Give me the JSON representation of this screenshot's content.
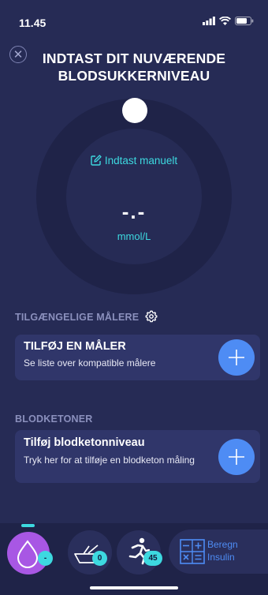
{
  "status_bar": {
    "time": "11.45"
  },
  "header": {
    "title": "INDTAST DIT NUVÆRENDE BLODSUKKERNIVEAU"
  },
  "dial": {
    "manual_entry_label": "Indtast manuelt",
    "reading": "-.-",
    "unit": "mmol/L"
  },
  "meters": {
    "section_label": "TILGÆNGELIGE MÅLERE",
    "card_title": "TILFØJ EN MÅLER",
    "card_subtitle": "Se liste over kompatible målere"
  },
  "ketones": {
    "section_label": "BLODKETONER",
    "card_title": "Tilføj blodketonniveau",
    "card_subtitle": "Tryk her for at tilføje en blodketon måling"
  },
  "tab_bar": {
    "glucose_badge": "-",
    "food_badge": "0",
    "activity_badge": "45",
    "calculate_label_line1": "Beregn",
    "calculate_label_line2": "Insulin"
  },
  "colors": {
    "background": "#262b55",
    "accent_cyan": "#3dd9e0",
    "accent_blue": "#4e8cf4",
    "glucose_tab": "#a857e4"
  }
}
